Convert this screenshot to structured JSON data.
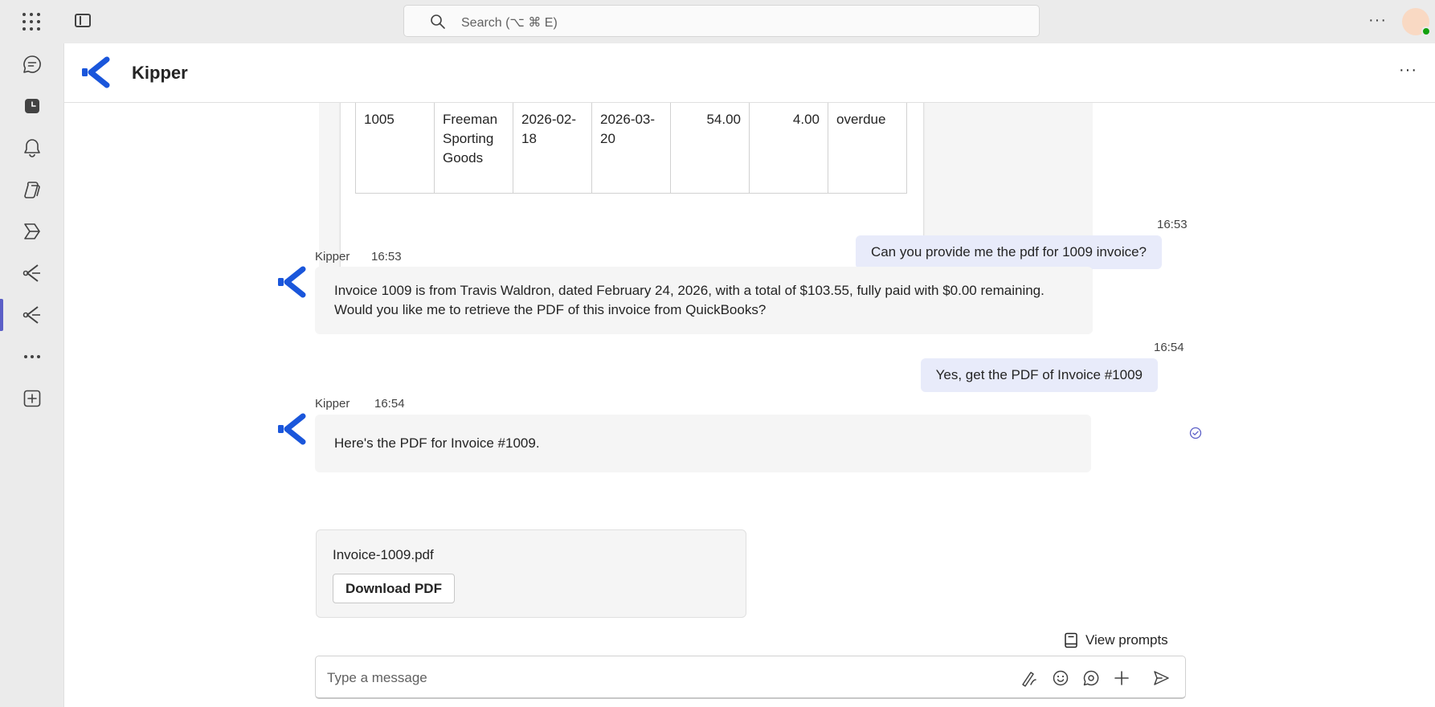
{
  "topbar": {
    "search_placeholder": "Search (⌥ ⌘ E)",
    "more_label": "···"
  },
  "rail": {
    "icons": [
      "chat-icon",
      "calendar-icon",
      "bell-icon",
      "copilot-icon",
      "power-automate-icon",
      "kipper-app-icon",
      "kipper-app-active-icon",
      "more-apps-icon",
      "add-app-icon"
    ],
    "accent_color": "#5b5fc7"
  },
  "header": {
    "title": "Kipper",
    "more_label": "···"
  },
  "table_row": {
    "cells": [
      "1005",
      "Freeman Sporting Goods",
      "2026-02-18",
      "2026-03-20",
      "54.00",
      "4.00",
      "overdue"
    ]
  },
  "messages": [
    {
      "type": "user",
      "time": "16:53",
      "text": "Can you provide me the pdf for 1009 invoice?"
    },
    {
      "type": "bot",
      "sender": "Kipper",
      "time": "16:53",
      "lines": [
        "Invoice 1009 is from Travis Waldron, dated February 24, 2026, with a total of $103.55, fully paid with $0.00 remaining.",
        "Would you like me to retrieve the PDF of this invoice from QuickBooks?"
      ]
    },
    {
      "type": "user",
      "time": "16:54",
      "text": "Yes, get the PDF of Invoice #1009"
    },
    {
      "type": "bot",
      "sender": "Kipper",
      "time": "16:54",
      "text": "Here's the PDF for Invoice #1009."
    }
  ],
  "file_card": {
    "filename": "Invoice-1009.pdf",
    "button_label": "Download PDF"
  },
  "composer": {
    "view_prompts_label": "View prompts",
    "placeholder": "Type a message"
  },
  "colors": {
    "brand": "#1a56db",
    "user_bubble": "#e8ebfa",
    "bot_bubble": "#f5f5f5"
  }
}
